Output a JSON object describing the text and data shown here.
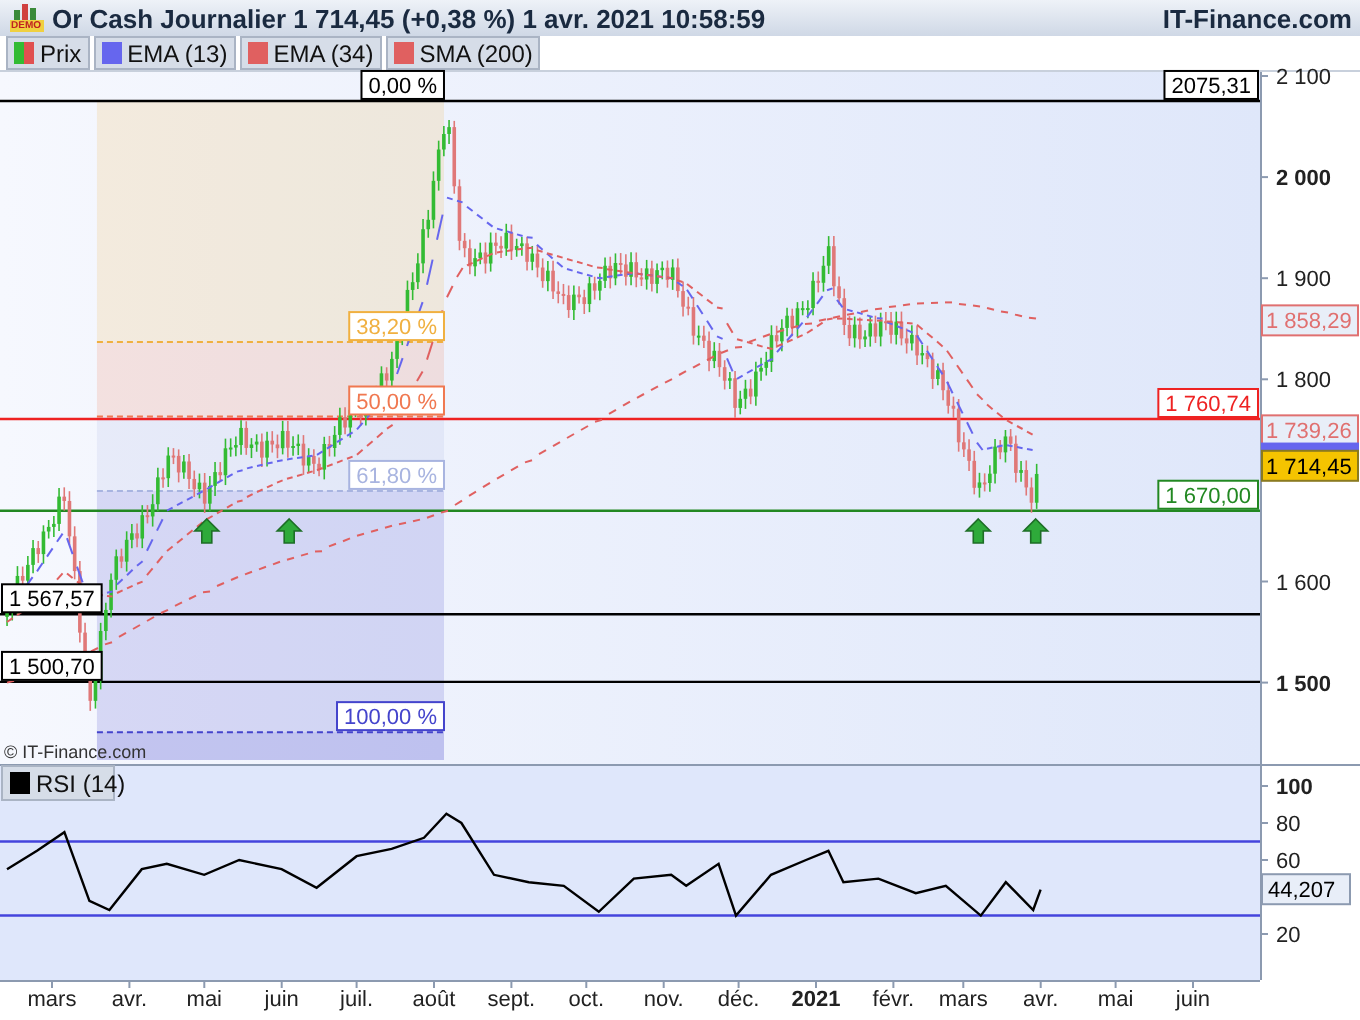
{
  "header": {
    "logo": "DEMO",
    "title": "Or Cash Journalier 1 714,45 (+0,38 %) 1 avr. 2021 10:58:59",
    "site": "IT-Finance.com"
  },
  "legend": [
    {
      "label": "Prix",
      "color": "#33bb33"
    },
    {
      "label": "EMA (13)",
      "color": "#6666ee"
    },
    {
      "label": "EMA (34)",
      "color": "#e06060"
    },
    {
      "label": "SMA (200)",
      "color": "#e06060"
    }
  ],
  "price_panel": {
    "fib_levels": [
      {
        "label": "0,00 %",
        "color": "#000000"
      },
      {
        "label": "38,20 %",
        "color": "#f0b040"
      },
      {
        "label": "50,00 %",
        "color": "#f07850"
      },
      {
        "label": "61,80 %",
        "color": "#a8b4e0"
      },
      {
        "label": "100,00 %",
        "color": "#4444cc"
      }
    ],
    "level_lines": [
      {
        "label": "2075,31",
        "kind": "right",
        "color": "#000000"
      },
      {
        "label": "1 760,74",
        "kind": "right",
        "color": "#ee2222"
      },
      {
        "label": "1 670,00",
        "kind": "right",
        "color": "#228822"
      },
      {
        "label": "1 567,57",
        "kind": "left",
        "color": "#000000"
      },
      {
        "label": "1 500,70",
        "kind": "left",
        "color": "#000000"
      }
    ],
    "price_tags": [
      {
        "kind": "indicator",
        "label": "1 858,29",
        "color": "#e07070"
      },
      {
        "kind": "indicator",
        "label": "1 739,26",
        "color": "#e07070"
      },
      {
        "kind": "indicator",
        "color": "#6666ee"
      },
      {
        "kind": "current",
        "label": "1 714,45"
      }
    ],
    "y_axis": [
      "2 100",
      "2 000",
      "1 900",
      "1 800",
      "1 600",
      "1 500"
    ],
    "copyright": "© IT-Finance.com"
  },
  "rsi_panel": {
    "legend": "RSI (14)",
    "y_axis": [
      "100",
      "80",
      "60",
      "20"
    ],
    "tag": "44,207"
  },
  "x_axis": [
    {
      "label": "mars",
      "kind": "month"
    },
    {
      "label": "avr.",
      "kind": "month"
    },
    {
      "label": "mai",
      "kind": "month"
    },
    {
      "label": "juin",
      "kind": "month"
    },
    {
      "label": "juil.",
      "kind": "month"
    },
    {
      "label": "août",
      "kind": "month"
    },
    {
      "label": "sept.",
      "kind": "month"
    },
    {
      "label": "oct.",
      "kind": "month"
    },
    {
      "label": "nov.",
      "kind": "month"
    },
    {
      "label": "déc.",
      "kind": "month"
    },
    {
      "label": "2021",
      "kind": "year"
    },
    {
      "label": "févr.",
      "kind": "month"
    },
    {
      "label": "mars",
      "kind": "month"
    },
    {
      "label": "avr.",
      "kind": "month"
    },
    {
      "label": "mai",
      "kind": "month"
    },
    {
      "label": "juin",
      "kind": "month"
    }
  ]
}
